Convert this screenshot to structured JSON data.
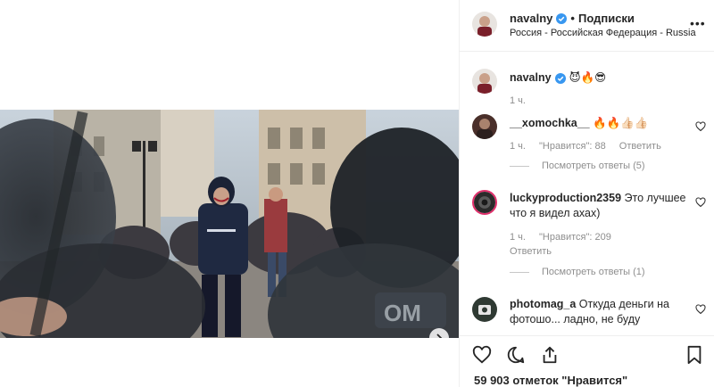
{
  "post": {
    "username": "navalny",
    "separator": "•",
    "follow_label": "Подписки",
    "location": "Россия - Российская Федерация - Russia",
    "more_label": "•••"
  },
  "caption": {
    "username": "navalny",
    "text": "😈🔥😎",
    "time": "1 ч."
  },
  "comments": [
    {
      "username": "__xomochka__",
      "text": "🔥🔥👍🏻👍🏻",
      "time": "1 ч.",
      "likes": "\"Нравится\": 88",
      "reply_label": "Ответить",
      "view_replies": "Посмотреть ответы (5)"
    },
    {
      "username": "luckyproduction2359",
      "text": "Это лучшее что я видел ахах)",
      "time": "1 ч.",
      "likes": "\"Нравится\": 209",
      "reply_label": "Ответить",
      "view_replies": "Посмотреть ответы (1)"
    },
    {
      "username": "photomag_a",
      "text": "Откуда деньги на фотошо... ладно, не буду"
    }
  ],
  "footer": {
    "likes_text": "59 903 отметок \"Нравится\""
  },
  "icons": {
    "verified": "verified-badge-icon",
    "next": "chevron-right-icon",
    "like": "heart-icon",
    "comment": "comment-icon",
    "share": "share-icon",
    "save": "bookmark-icon"
  },
  "colors": {
    "verified": "#3897f0",
    "text": "#262626",
    "muted": "#8e8e8e",
    "border": "#efefef"
  }
}
